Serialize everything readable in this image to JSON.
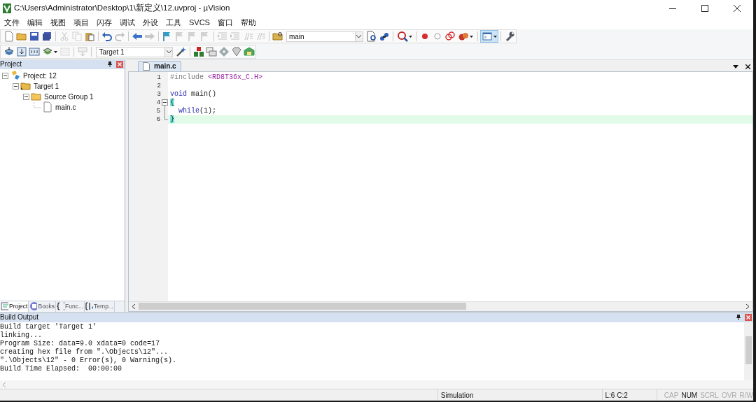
{
  "window": {
    "title": "C:\\Users\\Administrator\\Desktop\\1\\新定义\\12.uvproj - µVision"
  },
  "menu": [
    "文件",
    "编辑",
    "视图",
    "项目",
    "闪存",
    "调试",
    "外设",
    "工具",
    "SVCS",
    "窗口",
    "帮助"
  ],
  "toolbar_1": [
    {
      "kind": "button",
      "disabled": false
    },
    {
      "kind": "button",
      "disabled": false
    },
    {
      "kind": "button",
      "disabled": false
    },
    {
      "kind": "button",
      "disabled": false
    },
    {
      "kind": "separator"
    },
    {
      "kind": "button",
      "disabled": true
    },
    {
      "kind": "button",
      "disabled": true
    },
    {
      "kind": "button",
      "disabled": false
    },
    {
      "kind": "separator"
    },
    {
      "kind": "button",
      "disabled": false
    },
    {
      "kind": "button",
      "disabled": true
    },
    {
      "kind": "separator"
    },
    {
      "kind": "button",
      "disabled": false
    },
    {
      "kind": "button",
      "disabled": true
    },
    {
      "kind": "separator"
    },
    {
      "kind": "button",
      "disabled": false
    },
    {
      "kind": "button",
      "disabled": true
    },
    {
      "kind": "button",
      "disabled": true
    },
    {
      "kind": "button",
      "disabled": true
    },
    {
      "kind": "separator"
    },
    {
      "kind": "button",
      "disabled": true
    },
    {
      "kind": "button",
      "disabled": true
    },
    {
      "kind": "button",
      "disabled": true
    },
    {
      "kind": "button",
      "disabled": true
    },
    {
      "kind": "separator"
    },
    {
      "kind": "button",
      "disabled": false
    },
    {
      "kind": "combo",
      "value": "main"
    },
    {
      "kind": "button",
      "disabled": false
    },
    {
      "kind": "button",
      "disabled": false
    },
    {
      "kind": "separator"
    },
    {
      "kind": "dropdown",
      "disabled": false,
      "selected": false
    },
    {
      "kind": "separator"
    },
    {
      "kind": "button",
      "disabled": false
    },
    {
      "kind": "button",
      "disabled": false
    },
    {
      "kind": "button",
      "disabled": false
    },
    {
      "kind": "dropdown",
      "disabled": false,
      "selected": false
    },
    {
      "kind": "separator"
    },
    {
      "kind": "dropdown",
      "disabled": false,
      "selected": true
    },
    {
      "kind": "separator"
    },
    {
      "kind": "button",
      "disabled": false
    }
  ],
  "toolbar_2": [
    {
      "kind": "button",
      "disabled": false
    },
    {
      "kind": "button",
      "disabled": false
    },
    {
      "kind": "button",
      "disabled": false
    },
    {
      "kind": "dropdown",
      "disabled": false,
      "selected": false
    },
    {
      "kind": "button",
      "disabled": true
    },
    {
      "kind": "separator"
    },
    {
      "kind": "button",
      "disabled": true
    },
    {
      "kind": "separator"
    },
    {
      "kind": "combo",
      "value": "Target 1"
    },
    {
      "kind": "button",
      "disabled": false
    },
    {
      "kind": "separator"
    },
    {
      "kind": "button",
      "disabled": false
    },
    {
      "kind": "button",
      "disabled": false
    },
    {
      "kind": "button",
      "disabled": false
    },
    {
      "kind": "button",
      "disabled": false
    },
    {
      "kind": "button",
      "disabled": false
    }
  ],
  "project_panel": {
    "title": "Project",
    "tree": [
      {
        "label": "Project: 12",
        "kind": "project",
        "expanded": true,
        "children": [
          {
            "label": "Target 1",
            "kind": "target",
            "expanded": true,
            "children": [
              {
                "label": "Source Group 1",
                "kind": "group",
                "expanded": true,
                "children": [
                  {
                    "label": "main.c",
                    "kind": "file"
                  }
                ]
              }
            ]
          }
        ]
      }
    ],
    "tabs": [
      {
        "label": "Project",
        "selected": true
      },
      {
        "label": "Books",
        "selected": false
      },
      {
        "label": "Func...",
        "selected": false
      },
      {
        "label": "Temp...",
        "selected": false
      }
    ]
  },
  "editor": {
    "tabs": [
      {
        "label": "main.c",
        "selected": true
      }
    ],
    "lines": [
      {
        "number": "1",
        "current": false,
        "kind": "plain",
        "segments": [
          {
            "kind": "directive",
            "text": "#include"
          },
          {
            "kind": "header",
            "text": " <RD8T36x_C.H>"
          }
        ]
      },
      {
        "number": "2",
        "current": false,
        "kind": "plain"
      },
      {
        "number": "3",
        "current": false,
        "kind": "plain",
        "segments": [
          {
            "kind": "keyword",
            "text": "void"
          },
          {
            "kind": "text",
            "text": " main()"
          }
        ]
      },
      {
        "number": "4",
        "current": false,
        "kind": "fold_start",
        "segments": [
          {
            "kind": "brace",
            "text": "{"
          }
        ]
      },
      {
        "number": "5",
        "current": false,
        "kind": "fold_body",
        "segments": [
          {
            "kind": "keyword",
            "text": "  while"
          },
          {
            "kind": "text",
            "text": "(1);"
          }
        ]
      },
      {
        "number": "6",
        "current": true,
        "kind": "fold_end",
        "segments": [
          {
            "kind": "brace",
            "text": "}"
          }
        ]
      }
    ]
  },
  "build_output": {
    "title": "Build Output",
    "lines": [
      "Build target 'Target 1'",
      "linking...",
      "Program Size: data=9.0 xdata=0 code=17",
      "creating hex file from \".\\Objects\\12\"...",
      "\".\\Objects\\12\" - 0 Error(s), 0 Warning(s).",
      "Build Time Elapsed:  00:00:00"
    ]
  },
  "status_bar": {
    "mode": "Simulation",
    "position": "L:6 C:2",
    "indicators": [
      {
        "label": "CAP",
        "on": false
      },
      {
        "label": "NUM",
        "on": true
      },
      {
        "label": "SCRL",
        "on": false
      },
      {
        "label": "OVR",
        "on": false
      },
      {
        "label": "R/W",
        "on": false
      }
    ]
  }
}
